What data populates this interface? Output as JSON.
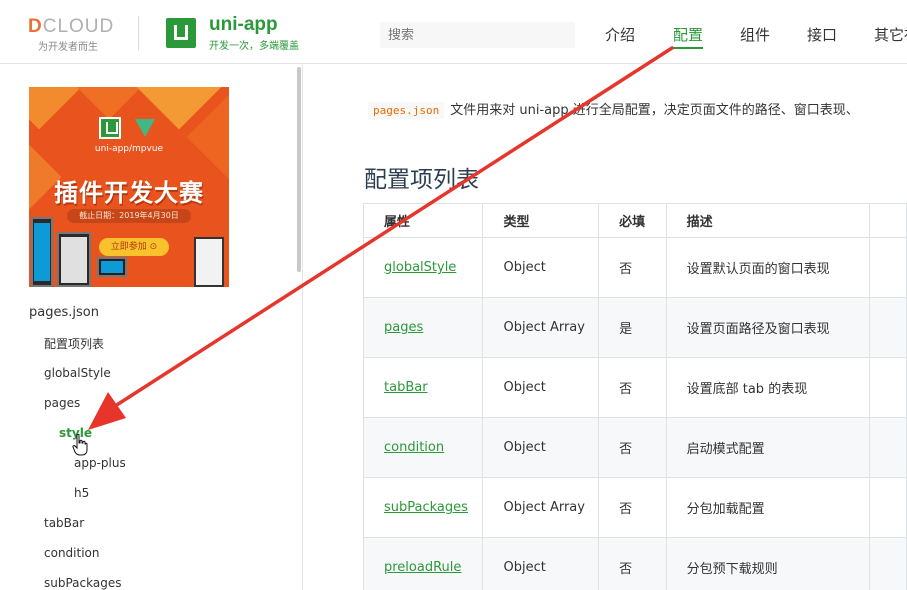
{
  "header": {
    "dcloud_brand_first": "D",
    "dcloud_brand_rest": "CLOUD",
    "dcloud_tagline": "为开发者而生",
    "uniapp_title": "uni-app",
    "uniapp_tagline": "开发一次，多端覆盖",
    "search_placeholder": "搜索",
    "nav": [
      "介绍",
      "配置",
      "组件",
      "接口",
      "其它社"
    ],
    "active_nav_index": 1,
    "accent": "#2b9939"
  },
  "banner": {
    "caption": "uni-app/mpvue",
    "title": "插件开发大赛",
    "date": "截止日期：2019年4月30日",
    "button": "立即参加 ⊙"
  },
  "sidebar": {
    "items": [
      {
        "label": "pages.json",
        "level": 0
      },
      {
        "label": "配置项列表",
        "level": 1
      },
      {
        "label": "globalStyle",
        "level": 1
      },
      {
        "label": "pages",
        "level": 1
      },
      {
        "label": "style",
        "level": 2,
        "active": true
      },
      {
        "label": "app-plus",
        "level": 3
      },
      {
        "label": "h5",
        "level": 3
      },
      {
        "label": "tabBar",
        "level": 1
      },
      {
        "label": "condition",
        "level": 1
      },
      {
        "label": "subPackages",
        "level": 1
      }
    ]
  },
  "main": {
    "intro_code": "pages.json",
    "intro_text": "文件用来对 uni-app 进行全局配置，决定页面文件的路径、窗口表现、",
    "section_title": "配置项列表",
    "table": {
      "headers": [
        "属性",
        "类型",
        "必填",
        "描述"
      ],
      "rows": [
        {
          "prop": "globalStyle",
          "type": "Object",
          "required": "否",
          "desc": "设置默认页面的窗口表现"
        },
        {
          "prop": "pages",
          "type": "Object Array",
          "required": "是",
          "desc": "设置页面路径及窗口表现"
        },
        {
          "prop": "tabBar",
          "type": "Object",
          "required": "否",
          "desc": "设置底部 tab 的表现"
        },
        {
          "prop": "condition",
          "type": "Object",
          "required": "否",
          "desc": "启动模式配置"
        },
        {
          "prop": "subPackages",
          "type": "Object Array",
          "required": "否",
          "desc": "分包加载配置"
        },
        {
          "prop": "preloadRule",
          "type": "Object",
          "required": "否",
          "desc": "分包预下载规则"
        }
      ]
    }
  },
  "annotation_color": "#e8352c"
}
